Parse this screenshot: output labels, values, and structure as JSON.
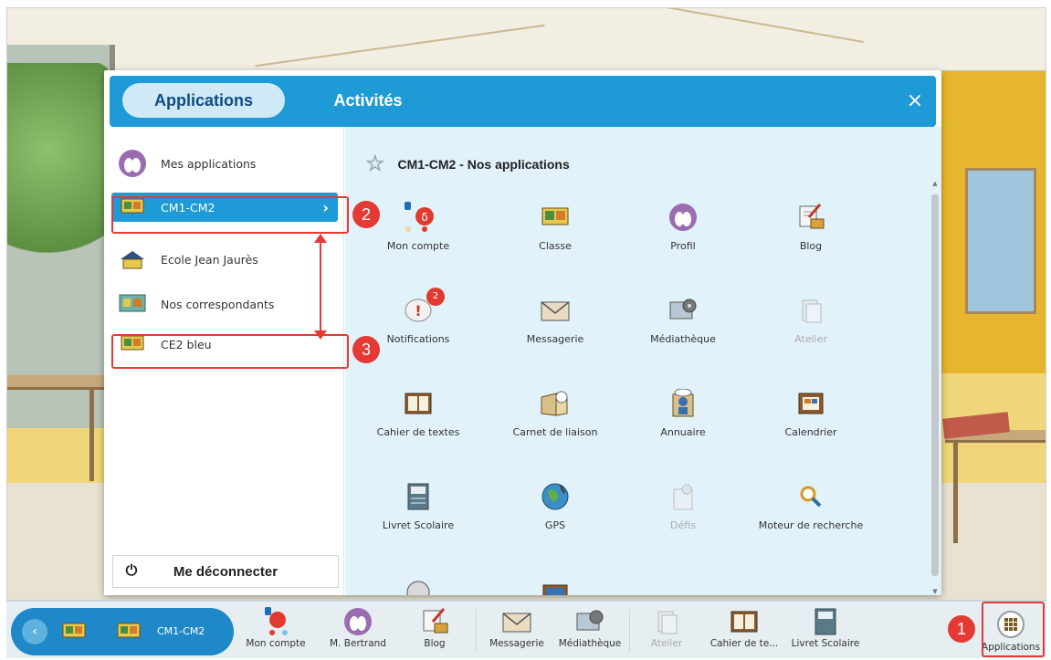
{
  "modal": {
    "tabs": [
      {
        "label": "Applications"
      },
      {
        "label": "Activités"
      }
    ],
    "close": "×",
    "sidebar": {
      "items": [
        {
          "label": "Mes applications"
        },
        {
          "label": "CM1-CM2"
        },
        {
          "label": "Ecole Jean Jaurès"
        },
        {
          "label": "Nos correspondants"
        },
        {
          "label": "CE2 bleu"
        }
      ],
      "logout": "Me déconnecter"
    },
    "content": {
      "title": "CM1-CM2 - Nos applications",
      "apps": [
        {
          "label": "Mon compte"
        },
        {
          "label": "Classe"
        },
        {
          "label": "Profil"
        },
        {
          "label": "Blog"
        },
        {
          "label": "Notifications",
          "badge": "2"
        },
        {
          "label": "Messagerie"
        },
        {
          "label": "Médiathèque"
        },
        {
          "label": "Atelier"
        },
        {
          "label": "Cahier de textes"
        },
        {
          "label": "Carnet de liaison"
        },
        {
          "label": "Annuaire"
        },
        {
          "label": "Calendrier"
        },
        {
          "label": "Livret Scolaire"
        },
        {
          "label": "GPS"
        },
        {
          "label": "Défis"
        },
        {
          "label": "Moteur de recherche"
        }
      ]
    }
  },
  "annotations": {
    "n1": "1",
    "n2": "2",
    "n3": "3"
  },
  "taskbar": {
    "class_label": "CM1-CM2",
    "items": [
      {
        "label": "Mon compte"
      },
      {
        "label": "M. Bertrand"
      },
      {
        "label": "Blog"
      },
      {
        "label": "Messagerie"
      },
      {
        "label": "Médiathèque"
      },
      {
        "label": "Atelier"
      },
      {
        "label": "Cahier de te..."
      },
      {
        "label": "Livret Scolaire"
      }
    ],
    "apps_label": "Applications"
  },
  "colors": {
    "accent": "#1e9ad6",
    "annotation": "#e53935",
    "panel": "#e2f2fa"
  }
}
